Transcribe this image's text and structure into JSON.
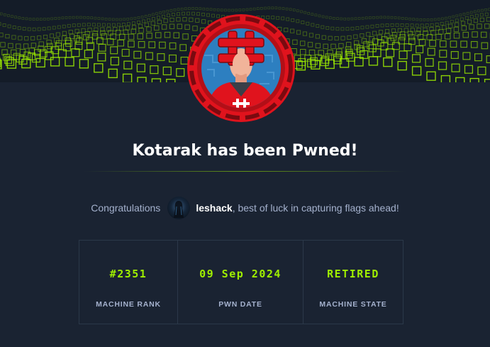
{
  "machine": {
    "name": "Kotarak"
  },
  "title": "Kotarak has been Pwned!",
  "congrats": {
    "prefix": "Congratulations",
    "user": "leshack",
    "suffix": ", best of luck in capturing flags ahead!"
  },
  "stats": [
    {
      "value": "#2351",
      "label": "MACHINE RANK"
    },
    {
      "value": "09 Sep 2024",
      "label": "PWN DATE"
    },
    {
      "value": "RETIRED",
      "label": "MACHINE STATE"
    }
  ],
  "colors": {
    "background": "#1a2332",
    "accent": "#9fef00",
    "muted_text": "#a4b1cd",
    "badge_red": "#e0131d"
  },
  "icons": [
    "machine-avatar-icon",
    "user-avatar-icon"
  ]
}
